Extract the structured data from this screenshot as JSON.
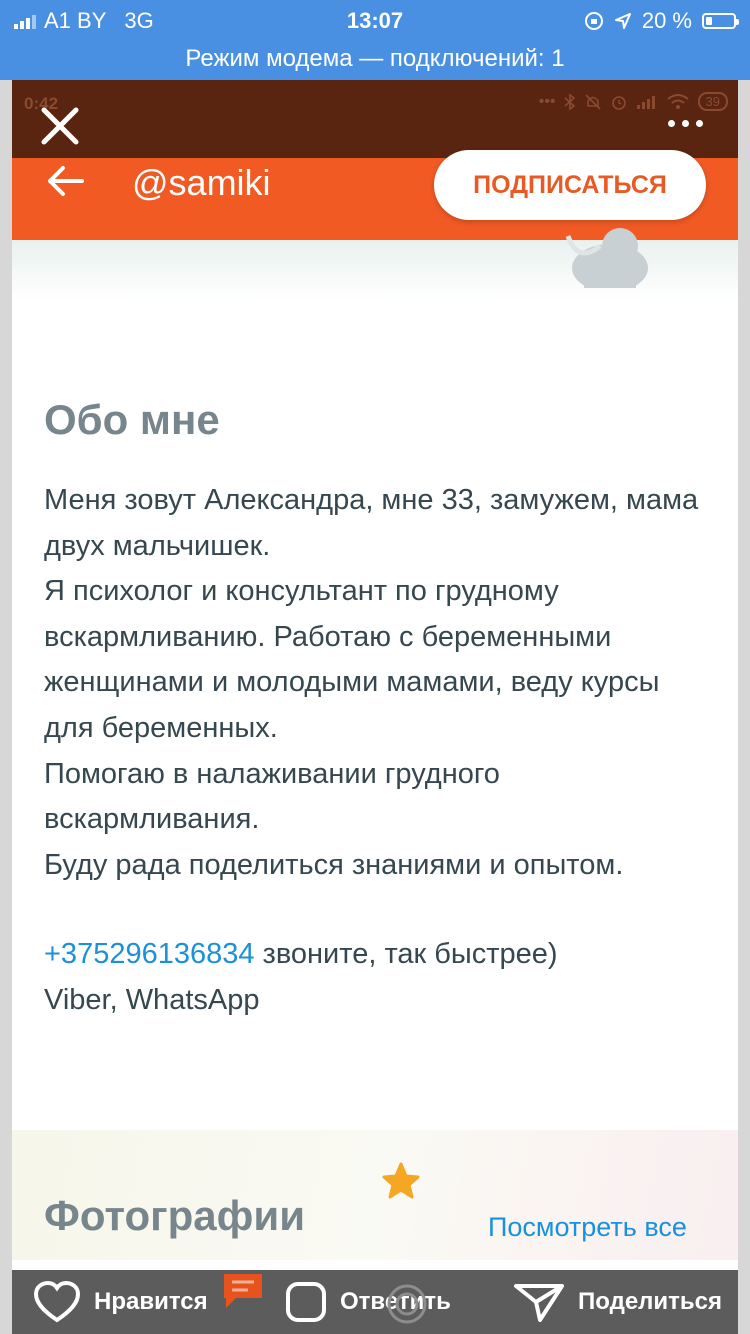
{
  "ios_status": {
    "carrier": "A1 BY",
    "network": "3G",
    "time": "13:07",
    "battery": "20 %",
    "battery_level": 0.2
  },
  "hotspot_banner": "Режим модема — подключений: 1",
  "android_status": {
    "time": "0:42",
    "battery": "39"
  },
  "header": {
    "username": "@samiki",
    "subscribe_label": "ПОДПИСАТЬСЯ"
  },
  "about": {
    "title": "Обо мне",
    "lines": [
      "Меня зовут Александра, мне 33, замужем, мама двух мальчишек.",
      "Я психолог и консультант по грудному вскармливанию. Работаю с беременными женщинами и молодыми мамами, веду курсы для беременных.",
      "Помогаю в налаживании грудного вскармливания.",
      "Буду рада поделиться знаниями и опытом."
    ],
    "phone": "+375296136834",
    "phone_note": " звоните, так быстрее)",
    "messengers": "Viber, WhatsApp"
  },
  "photos": {
    "title": "Фотографии",
    "see_all": "Посмотреть все"
  },
  "bottom_bar": {
    "like": "Нравится",
    "reply": "Ответить",
    "share": "Поделиться"
  },
  "colors": {
    "ios_blue": "#4a90e2",
    "app_orange": "#f25a24",
    "android_status_brown": "#5a2510",
    "link_blue": "#1a91da",
    "heading_gray": "#77858d",
    "text_dark": "#37474f"
  },
  "icons": [
    "close-icon",
    "more-icon",
    "back-arrow-icon",
    "heart-icon",
    "comment-icon",
    "reply-icon",
    "share-icon",
    "star-icon",
    "location-icon",
    "alarm-icon",
    "wifi-icon",
    "bluetooth-icon"
  ]
}
